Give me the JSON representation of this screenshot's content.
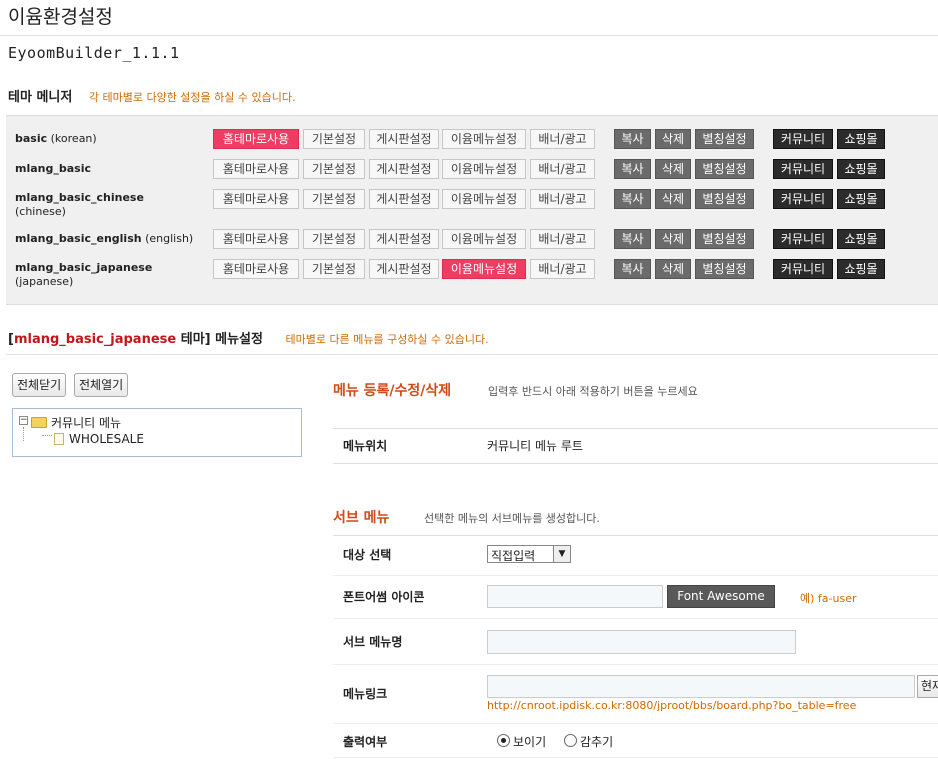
{
  "page_title": "이윰환경설정",
  "version": "EyoomBuilder_1.1.1",
  "theme_manager": {
    "title": "테마 메니저",
    "hint": "각 테마별로 다양한 설정을 하실 수 있습니다.",
    "buttons": {
      "homepage": "홈테마로사용",
      "basic": "기본설정",
      "board": "게시판설정",
      "menu": "이윰메뉴설정",
      "banner": "배너/광고",
      "copy": "복사",
      "delete": "삭제",
      "alias": "별칭설정",
      "community": "커뮤니티",
      "shop": "쇼핑몰"
    },
    "themes": [
      {
        "name": "basic",
        "sub": "(korean)"
      },
      {
        "name": "mlang_basic",
        "sub": ""
      },
      {
        "name": "mlang_basic_chinese",
        "sub": "(chinese)"
      },
      {
        "name": "mlang_basic_english",
        "sub": "(english)"
      },
      {
        "name": "mlang_basic_japanese",
        "sub": "(japanese)"
      }
    ]
  },
  "menu_settings": {
    "title_prefix": "[",
    "theme_name": "mlang_basic_japanese",
    "title_suffix": " 테마] 메뉴설정",
    "hint": "테마별로 다른 메뉴를 구성하실 수 있습니다.",
    "collapse_all": "전체닫기",
    "expand_all": "전체열기",
    "tree": {
      "root": "커뮤니티 메뉴",
      "child": "WHOLESALE"
    }
  },
  "menu_edit": {
    "title": "메뉴 등록/수정/삭제",
    "hint": "입력후 반드시 아래 적용하기 버튼을 누르세요",
    "location_label": "메뉴위치",
    "location_value": "커뮤니티 메뉴 루트"
  },
  "sub_menu": {
    "title": "서브 메뉴",
    "hint": "선택한 메뉴의 서브메뉴를 생성합니다.",
    "target_label": "대상 선택",
    "target_value": "직접입력",
    "icon_label": "폰트어썸 아이콘",
    "icon_button": "Font Awesome",
    "icon_example": "예) fa-user",
    "name_label": "서브 메뉴명",
    "link_label": "메뉴링크",
    "link_button": "현재",
    "link_example": "http://cnroot.ipdisk.co.kr:8080/jproot/bbs/board.php?bo_table=free",
    "display_label": "출력여부",
    "show_label": "보이기",
    "hide_label": "감추기"
  },
  "colors": {
    "accent_pink": "#ee3d63",
    "title_orange": "#d04a1a",
    "hint_orange": "#d06a00",
    "theme_red": "#c4151c"
  }
}
